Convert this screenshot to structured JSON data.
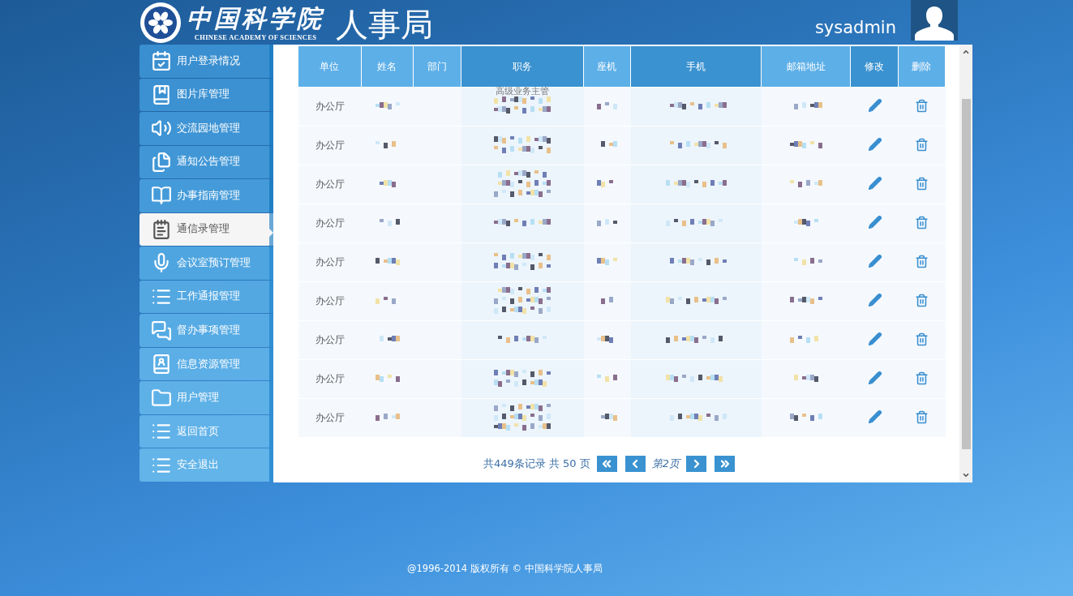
{
  "header": {
    "org_name": "中国科学院",
    "org_name_en": "CHINESE ACADEMY OF SCIENCES",
    "dept": "人事局",
    "username": "sysadmin"
  },
  "sidebar": {
    "items": [
      {
        "label": "用户登录情况",
        "selected": false
      },
      {
        "label": "图片库管理",
        "selected": false
      },
      {
        "label": "交流园地管理",
        "selected": false
      },
      {
        "label": "通知公告管理",
        "selected": false
      },
      {
        "label": "办事指南管理",
        "selected": false
      },
      {
        "label": "通信录管理",
        "selected": true
      },
      {
        "label": "会议室预订管理",
        "selected": false
      },
      {
        "label": "工作通报管理",
        "selected": false
      },
      {
        "label": "督办事项管理",
        "selected": false
      },
      {
        "label": "信息资源管理",
        "selected": false
      },
      {
        "label": "用户管理",
        "selected": false
      },
      {
        "label": "返回首页",
        "selected": false
      },
      {
        "label": "安全退出",
        "selected": false
      }
    ]
  },
  "table": {
    "columns": [
      "单位",
      "姓名",
      "部门",
      "职务",
      "座机",
      "手机",
      "邮箱地址",
      "修改",
      "删除"
    ],
    "rows": [
      {
        "unit": "办公厅",
        "title": "高级业务主管"
      },
      {
        "unit": "办公厅"
      },
      {
        "unit": "办公厅"
      },
      {
        "unit": "办公厅"
      },
      {
        "unit": "办公厅"
      },
      {
        "unit": "办公厅"
      },
      {
        "unit": "办公厅"
      },
      {
        "unit": "办公厅"
      },
      {
        "unit": "办公厅"
      }
    ]
  },
  "pagination": {
    "summary": "共449条记录 共 50 页",
    "current": "第2页"
  },
  "footer": "@1996-2014 版权所有 © 中国科学院人事局"
}
